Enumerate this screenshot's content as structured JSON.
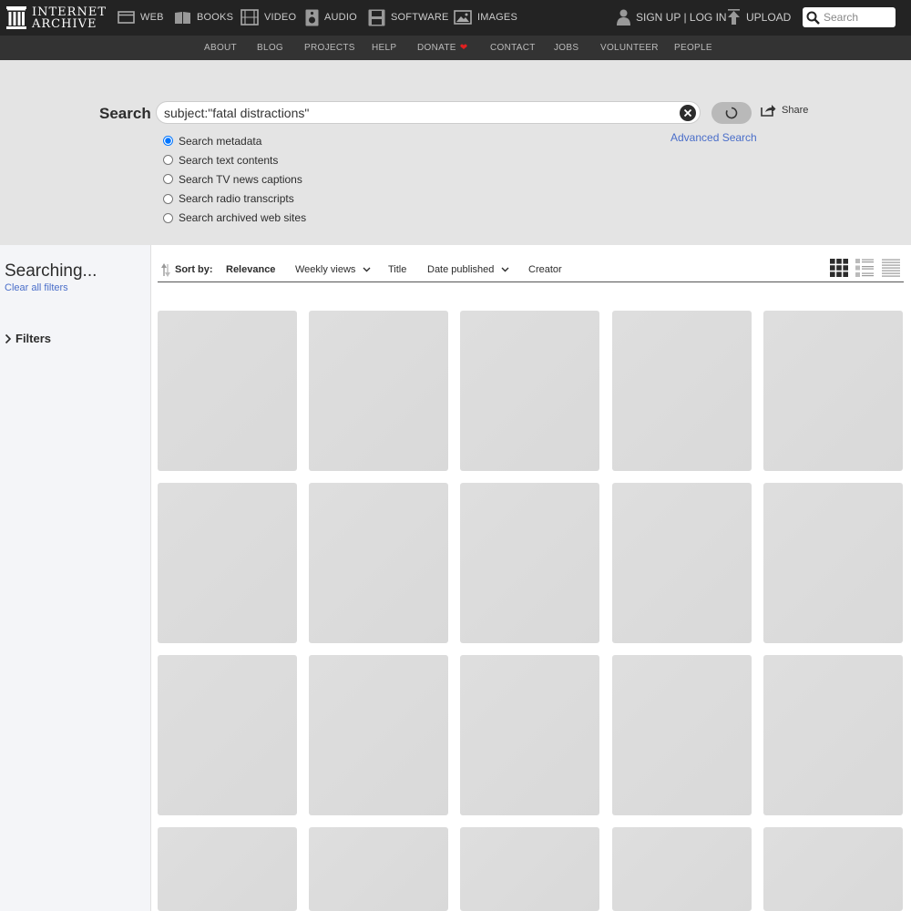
{
  "topnav": {
    "logo_line1": "INTERNET",
    "logo_line2": "ARCHIVE",
    "media": [
      {
        "label": "WEB",
        "icon": "web-icon"
      },
      {
        "label": "BOOKS",
        "icon": "books-icon"
      },
      {
        "label": "VIDEO",
        "icon": "video-icon"
      },
      {
        "label": "AUDIO",
        "icon": "audio-icon"
      },
      {
        "label": "SOFTWARE",
        "icon": "software-icon"
      },
      {
        "label": "IMAGES",
        "icon": "images-icon"
      }
    ],
    "signup_login": "SIGN UP | LOG IN",
    "upload": "UPLOAD",
    "search_placeholder": "Search"
  },
  "subnav": {
    "items": [
      "ABOUT",
      "BLOG",
      "PROJECTS",
      "HELP",
      "DONATE",
      "CONTACT",
      "JOBS",
      "VOLUNTEER",
      "PEOPLE"
    ]
  },
  "search": {
    "label": "Search",
    "query": "subject:\"fatal distractions\"",
    "share_label": "Share",
    "advanced_label": "Advanced Search",
    "options": [
      {
        "label": "Search metadata",
        "checked": true
      },
      {
        "label": "Search text contents",
        "checked": false
      },
      {
        "label": "Search TV news captions",
        "checked": false
      },
      {
        "label": "Search radio transcripts",
        "checked": false
      },
      {
        "label": "Search archived web sites",
        "checked": false
      }
    ]
  },
  "sidebar": {
    "status": "Searching...",
    "clear_filters": "Clear all filters",
    "filters_label": "Filters"
  },
  "sort": {
    "label": "Sort by:",
    "options": [
      {
        "label": "Relevance",
        "active": true,
        "dropdown": false
      },
      {
        "label": "Weekly views",
        "active": false,
        "dropdown": true
      },
      {
        "label": "Title",
        "active": false,
        "dropdown": false
      },
      {
        "label": "Date published",
        "active": false,
        "dropdown": true
      },
      {
        "label": "Creator",
        "active": false,
        "dropdown": false
      }
    ],
    "views": [
      "tile-view-icon",
      "list-detail-view-icon",
      "list-compact-view-icon"
    ]
  },
  "results": {
    "placeholder_tiles": 20
  }
}
